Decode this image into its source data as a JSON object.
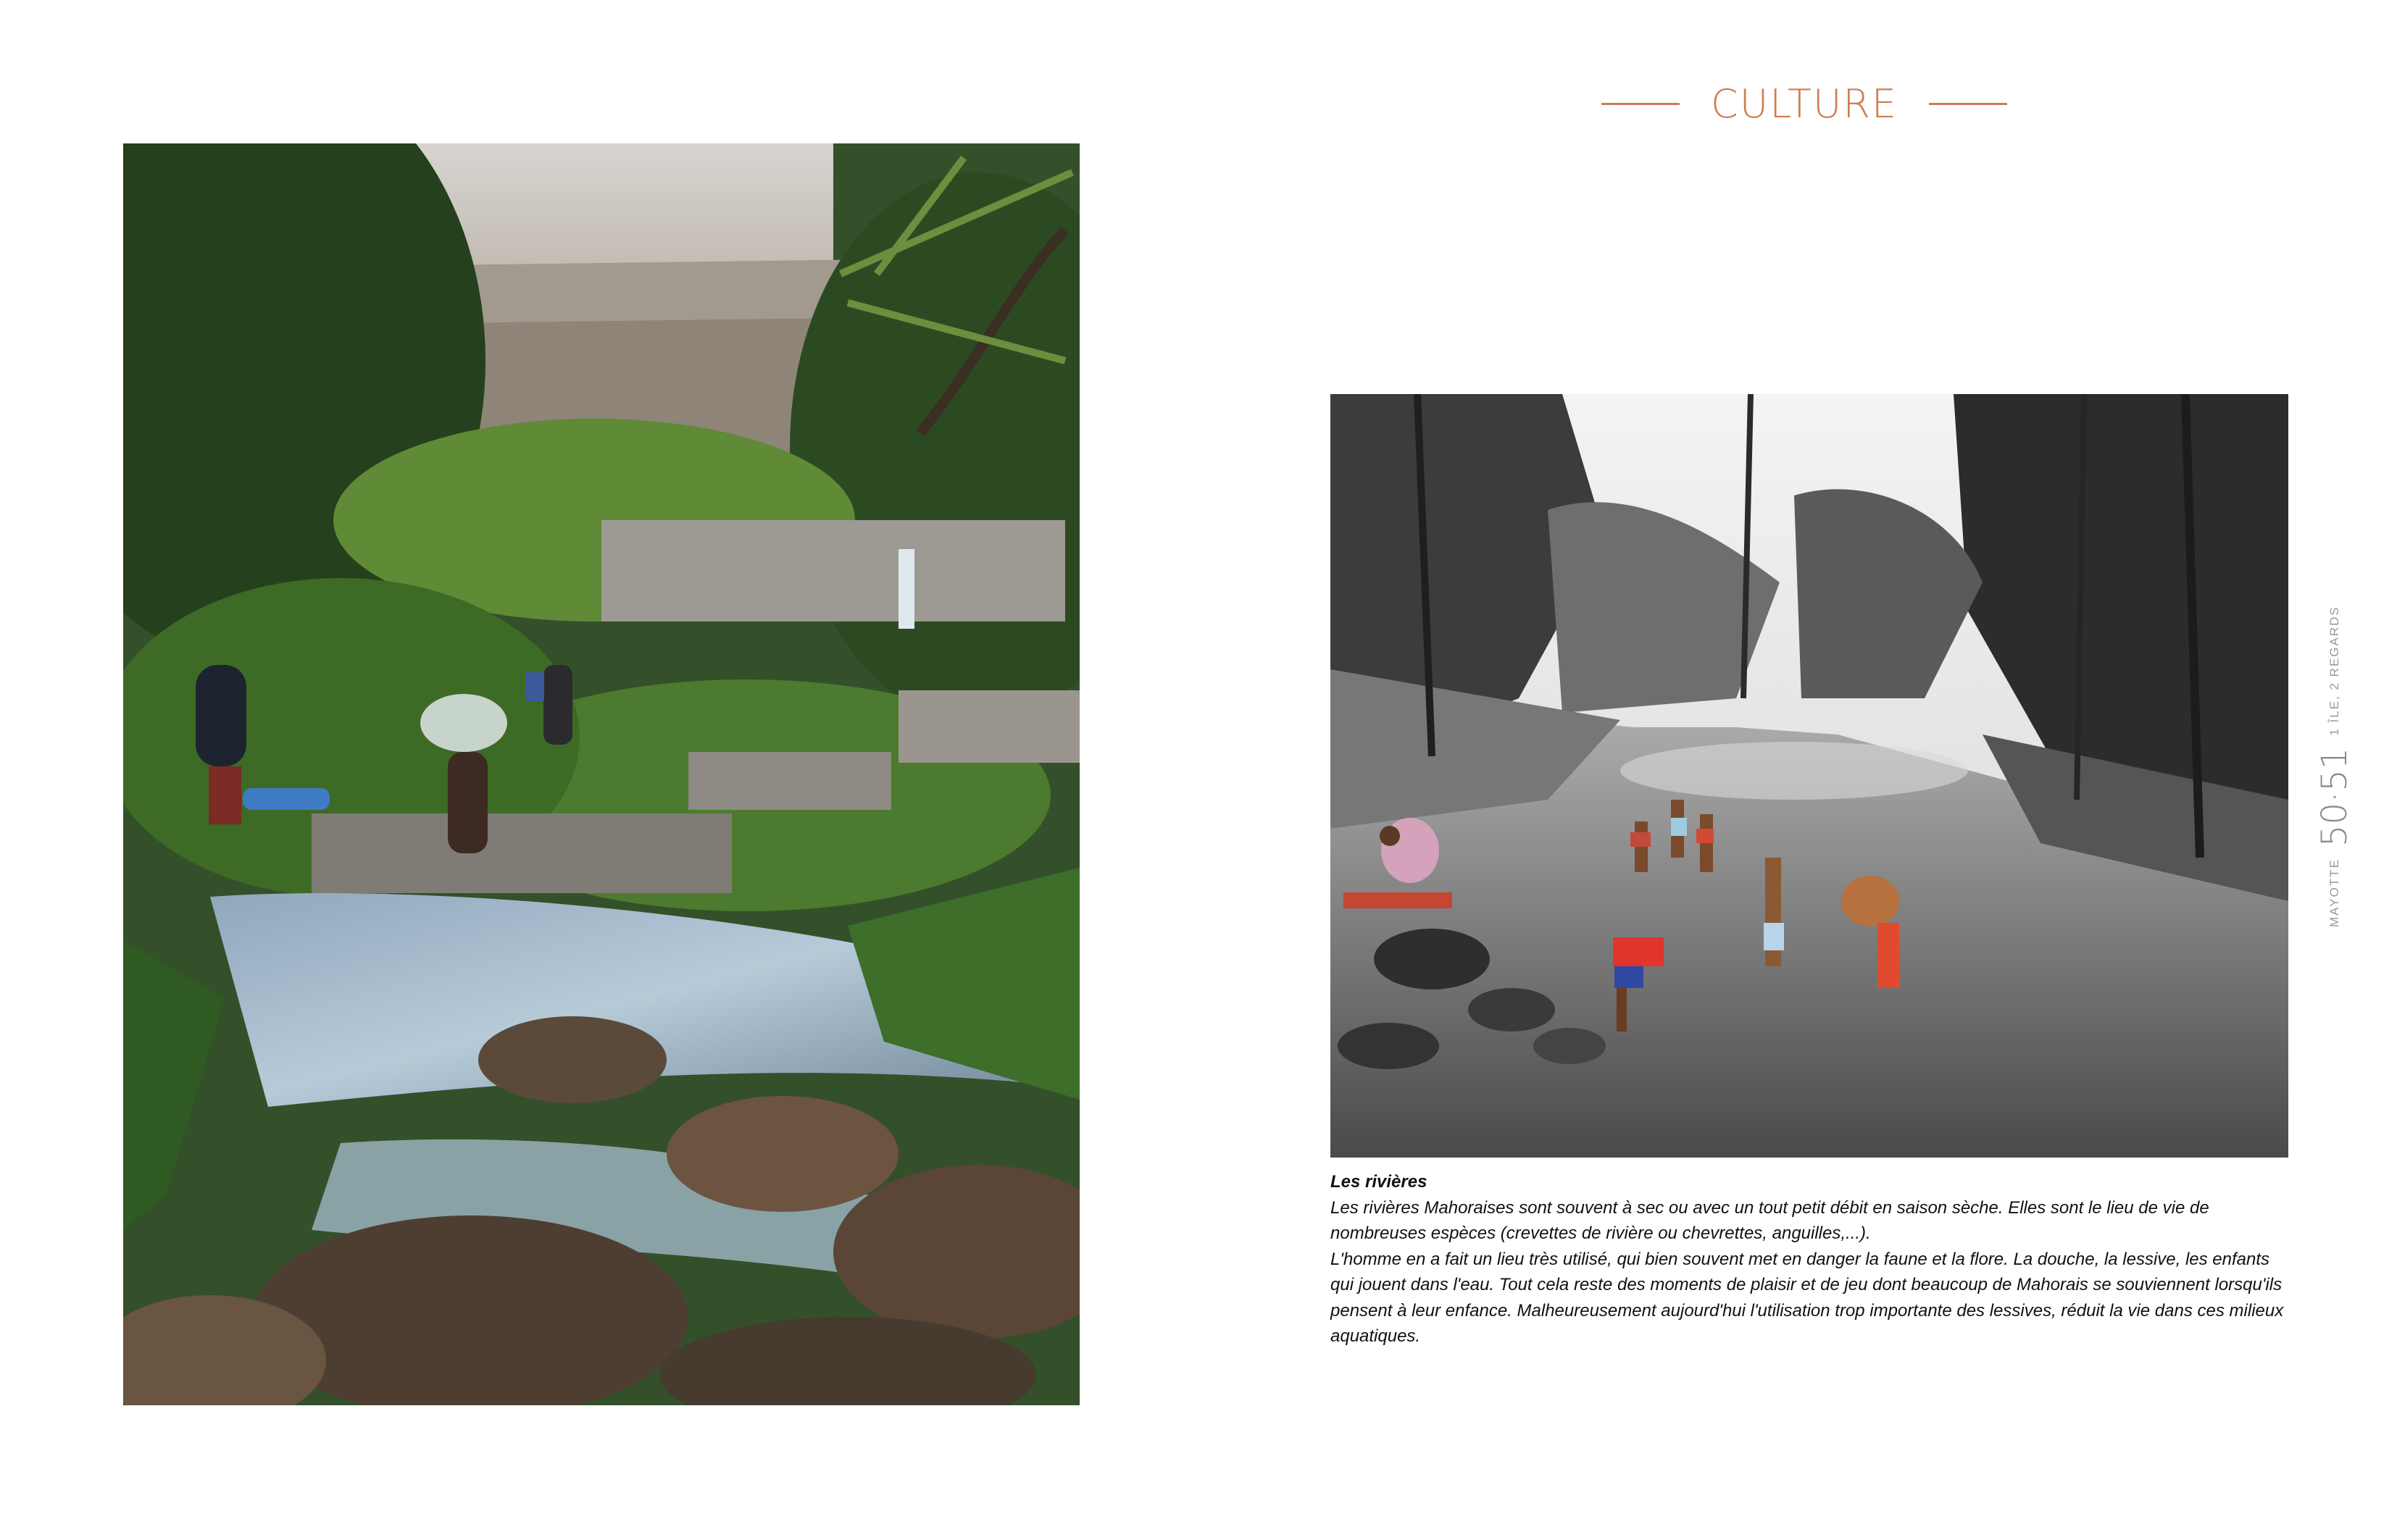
{
  "header": {
    "section_title": "CULTURE"
  },
  "images": {
    "left_photo": "Photograph: people washing at a forest river below a concrete weir",
    "right_painting": "Painting: children playing in a shallow river in a black-and-white forest"
  },
  "caption": {
    "title": "Les rivières",
    "paragraphs": [
      "Les rivières Mahoraises sont souvent à sec ou avec un tout petit débit en saison sèche. Elles sont le lieu de vie de nombreuses espèces (crevettes de rivière ou chevrettes, anguilles,...).",
      "L'homme en a fait un lieu très utilisé, qui bien souvent met en danger la faune et la flore. La douche, la lessive, les enfants qui jouent dans l'eau. Tout cela reste des moments de plaisir et de jeu dont beaucoup de Mahorais se souviennent lorsqu'ils pensent à leur enfance. Malheureusement aujourd'hui l'utilisation trop importante des lessives, réduit la vie dans ces milieux aquatiques."
    ]
  },
  "folio": {
    "place": "MAYOTTE",
    "pages": "50·51",
    "tagline": "1 ÎLE, 2 REGARDS"
  },
  "colors": {
    "accent": "#cf7b4f",
    "folio_grey": "#9a9a9a"
  }
}
